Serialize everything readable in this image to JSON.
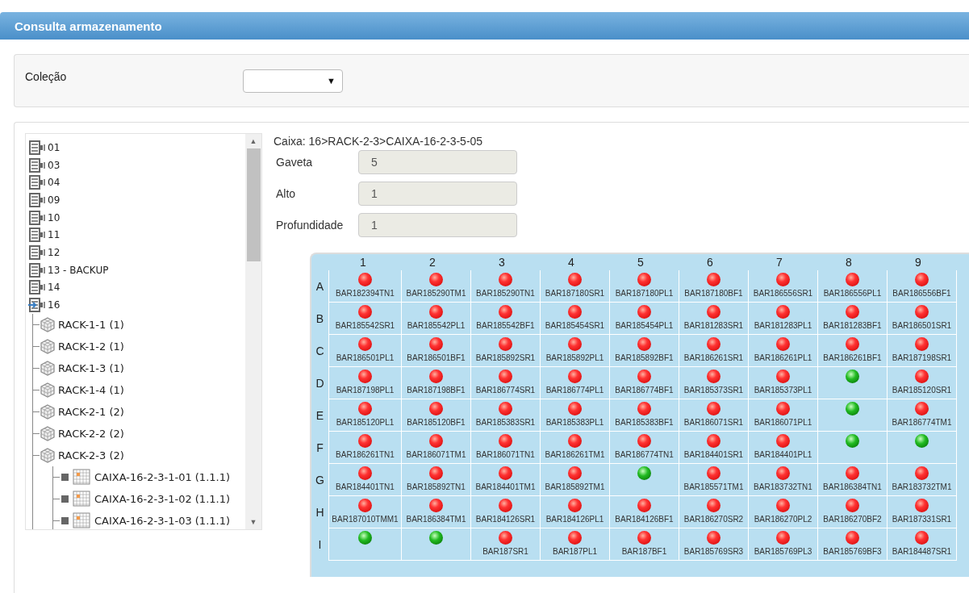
{
  "window": {
    "title": "Consulta armazenamento"
  },
  "filter": {
    "label": "Coleção",
    "select_arrow": "▼"
  },
  "tree": [
    {
      "label": "01",
      "expanded": false
    },
    {
      "label": "03",
      "expanded": false
    },
    {
      "label": "04",
      "expanded": false
    },
    {
      "label": "09",
      "expanded": false
    },
    {
      "label": "10",
      "expanded": false
    },
    {
      "label": "11",
      "expanded": false
    },
    {
      "label": "12",
      "expanded": false
    },
    {
      "label": "13 - BACKUP",
      "expanded": false
    },
    {
      "label": "14",
      "expanded": false
    },
    {
      "label": "16",
      "expanded": true,
      "children": [
        {
          "label": "RACK-1-1 (1)"
        },
        {
          "label": "RACK-1-2 (1)"
        },
        {
          "label": "RACK-1-3 (1)"
        },
        {
          "label": "RACK-1-4 (1)"
        },
        {
          "label": "RACK-2-1 (2)"
        },
        {
          "label": "RACK-2-2 (2)"
        },
        {
          "label": "RACK-2-3 (2)",
          "children": [
            {
              "label": "CAIXA-16-2-3-1-01 (1.1.1)"
            },
            {
              "label": "CAIXA-16-2-3-1-02 (1.1.1)"
            },
            {
              "label": "CAIXA-16-2-3-1-03 (1.1.1)"
            }
          ]
        }
      ]
    }
  ],
  "scroll_arrows": {
    "up": "▲",
    "down": "▼"
  },
  "detail": {
    "path": "Caixa: 16>RACK-2-3>CAIXA-16-2-3-5-05",
    "fields": [
      {
        "label": "Gaveta",
        "value": "5"
      },
      {
        "label": "Alto",
        "value": "1"
      },
      {
        "label": "Profundidade",
        "value": "1"
      }
    ]
  },
  "grid": {
    "columns": [
      "1",
      "2",
      "3",
      "4",
      "5",
      "6",
      "7",
      "8",
      "9"
    ],
    "rows": [
      {
        "label": "A",
        "cells": [
          {
            "occupied": true,
            "code": "BAR182394TN1"
          },
          {
            "occupied": true,
            "code": "BAR185290TM1"
          },
          {
            "occupied": true,
            "code": "BAR185290TN1"
          },
          {
            "occupied": true,
            "code": "BAR187180SR1"
          },
          {
            "occupied": true,
            "code": "BAR187180PL1"
          },
          {
            "occupied": true,
            "code": "BAR187180BF1"
          },
          {
            "occupied": true,
            "code": "BAR186556SR1"
          },
          {
            "occupied": true,
            "code": "BAR186556PL1"
          },
          {
            "occupied": true,
            "code": "BAR186556BF1"
          }
        ]
      },
      {
        "label": "B",
        "cells": [
          {
            "occupied": true,
            "code": "BAR185542SR1"
          },
          {
            "occupied": true,
            "code": "BAR185542PL1"
          },
          {
            "occupied": true,
            "code": "BAR185542BF1"
          },
          {
            "occupied": true,
            "code": "BAR185454SR1"
          },
          {
            "occupied": true,
            "code": "BAR185454PL1"
          },
          {
            "occupied": true,
            "code": "BAR181283SR1"
          },
          {
            "occupied": true,
            "code": "BAR181283PL1"
          },
          {
            "occupied": true,
            "code": "BAR181283BF1"
          },
          {
            "occupied": true,
            "code": "BAR186501SR1"
          }
        ]
      },
      {
        "label": "C",
        "cells": [
          {
            "occupied": true,
            "code": "BAR186501PL1"
          },
          {
            "occupied": true,
            "code": "BAR186501BF1"
          },
          {
            "occupied": true,
            "code": "BAR185892SR1"
          },
          {
            "occupied": true,
            "code": "BAR185892PL1"
          },
          {
            "occupied": true,
            "code": "BAR185892BF1"
          },
          {
            "occupied": true,
            "code": "BAR186261SR1"
          },
          {
            "occupied": true,
            "code": "BAR186261PL1"
          },
          {
            "occupied": true,
            "code": "BAR186261BF1"
          },
          {
            "occupied": true,
            "code": "BAR187198SR1"
          }
        ]
      },
      {
        "label": "D",
        "cells": [
          {
            "occupied": true,
            "code": "BAR187198PL1"
          },
          {
            "occupied": true,
            "code": "BAR187198BF1"
          },
          {
            "occupied": true,
            "code": "BAR186774SR1"
          },
          {
            "occupied": true,
            "code": "BAR186774PL1"
          },
          {
            "occupied": true,
            "code": "BAR186774BF1"
          },
          {
            "occupied": true,
            "code": "BAR185373SR1"
          },
          {
            "occupied": true,
            "code": "BAR185373PL1"
          },
          {
            "occupied": false
          },
          {
            "occupied": true,
            "code": "BAR185120SR1"
          }
        ]
      },
      {
        "label": "E",
        "cells": [
          {
            "occupied": true,
            "code": "BAR185120PL1"
          },
          {
            "occupied": true,
            "code": "BAR185120BF1"
          },
          {
            "occupied": true,
            "code": "BAR185383SR1"
          },
          {
            "occupied": true,
            "code": "BAR185383PL1"
          },
          {
            "occupied": true,
            "code": "BAR185383BF1"
          },
          {
            "occupied": true,
            "code": "BAR186071SR1"
          },
          {
            "occupied": true,
            "code": "BAR186071PL1"
          },
          {
            "occupied": false
          },
          {
            "occupied": true,
            "code": "BAR186774TM1"
          }
        ]
      },
      {
        "label": "F",
        "cells": [
          {
            "occupied": true,
            "code": "BAR186261TN1"
          },
          {
            "occupied": true,
            "code": "BAR186071TM1"
          },
          {
            "occupied": true,
            "code": "BAR186071TN1"
          },
          {
            "occupied": true,
            "code": "BAR186261TM1"
          },
          {
            "occupied": true,
            "code": "BAR186774TN1"
          },
          {
            "occupied": true,
            "code": "BAR184401SR1"
          },
          {
            "occupied": true,
            "code": "BAR184401PL1"
          },
          {
            "occupied": false
          },
          {
            "occupied": false
          }
        ]
      },
      {
        "label": "G",
        "cells": [
          {
            "occupied": true,
            "code": "BAR184401TN1"
          },
          {
            "occupied": true,
            "code": "BAR185892TN1"
          },
          {
            "occupied": true,
            "code": "BAR184401TM1"
          },
          {
            "occupied": true,
            "code": "BAR185892TM1"
          },
          {
            "occupied": false
          },
          {
            "occupied": true,
            "code": "BAR185571TM1"
          },
          {
            "occupied": true,
            "code": "BAR183732TN1"
          },
          {
            "occupied": true,
            "code": "BAR186384TN1"
          },
          {
            "occupied": true,
            "code": "BAR183732TM1"
          }
        ]
      },
      {
        "label": "H",
        "cells": [
          {
            "occupied": true,
            "code": "BAR187010TMM1"
          },
          {
            "occupied": true,
            "code": "BAR186384TM1"
          },
          {
            "occupied": true,
            "code": "BAR184126SR1"
          },
          {
            "occupied": true,
            "code": "BAR184126PL1"
          },
          {
            "occupied": true,
            "code": "BAR184126BF1"
          },
          {
            "occupied": true,
            "code": "BAR186270SR2"
          },
          {
            "occupied": true,
            "code": "BAR186270PL2"
          },
          {
            "occupied": true,
            "code": "BAR186270BF2"
          },
          {
            "occupied": true,
            "code": "BAR187331SR1"
          }
        ]
      },
      {
        "label": "I",
        "cells": [
          {
            "occupied": false
          },
          {
            "occupied": false
          },
          {
            "occupied": true,
            "code": "BAR187SR1"
          },
          {
            "occupied": true,
            "code": "BAR187PL1"
          },
          {
            "occupied": true,
            "code": "BAR187BF1"
          },
          {
            "occupied": true,
            "code": "BAR185769SR3"
          },
          {
            "occupied": true,
            "code": "BAR185769PL3"
          },
          {
            "occupied": true,
            "code": "BAR185769BF3"
          },
          {
            "occupied": true,
            "code": "BAR184487SR1"
          }
        ]
      }
    ]
  }
}
